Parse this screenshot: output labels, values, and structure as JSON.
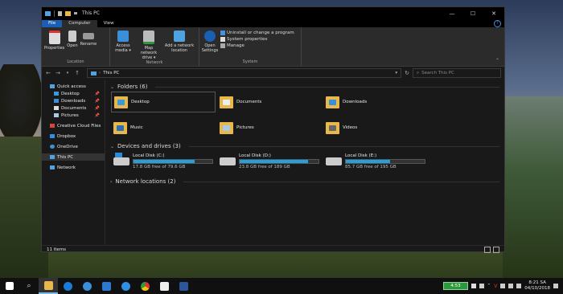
{
  "window": {
    "title": "This PC"
  },
  "ribbon": {
    "tabs": [
      {
        "label": "File"
      },
      {
        "label": "Computer"
      },
      {
        "label": "View"
      }
    ],
    "location": {
      "label": "Location",
      "buttons": [
        "Properties",
        "Open",
        "Rename"
      ]
    },
    "network": {
      "label": "Network",
      "buttons": [
        "Access media ▾",
        "Map network drive ▾",
        "Add a network location"
      ]
    },
    "system": {
      "label": "System",
      "open_settings": "Open Settings",
      "options": [
        "Uninstall or change a program",
        "System properties",
        "Manage"
      ]
    }
  },
  "address": {
    "path": "This PC",
    "search_placeholder": "Search This PC"
  },
  "nav": {
    "quick_access": "Quick access",
    "quick_items": [
      "Desktop",
      "Downloads",
      "Documents",
      "Pictures"
    ],
    "creative_cloud": "Creative Cloud Files",
    "dropbox": "Dropbox",
    "onedrive": "OneDrive",
    "this_pc": "This PC",
    "network": "Network"
  },
  "folders": {
    "header": "Folders (6)",
    "items": [
      "Desktop",
      "Documents",
      "Downloads",
      "Music",
      "Pictures",
      "Videos"
    ]
  },
  "drives": {
    "header": "Devices and drives (3)",
    "items": [
      {
        "name": "Local Disk (C:)",
        "free": "17.8 GB free of 79.6 GB",
        "used_fraction": 0.78
      },
      {
        "name": "Local Disk (D:)",
        "free": "23.8 GB free of 189 GB",
        "used_fraction": 0.87
      },
      {
        "name": "Local Disk (E:)",
        "free": "85.7 GB free of 195 GB",
        "used_fraction": 0.56
      }
    ]
  },
  "network_locations": {
    "header": "Network locations (2)"
  },
  "status": {
    "items": "11 items"
  },
  "taskbar": {
    "battery": "4:53",
    "time": "8:21 SA",
    "date": "04/10/2018"
  },
  "colors": {
    "accent": "#1b5fb5",
    "drive_bar": "#26a0da",
    "battery": "#2c9a3c"
  }
}
